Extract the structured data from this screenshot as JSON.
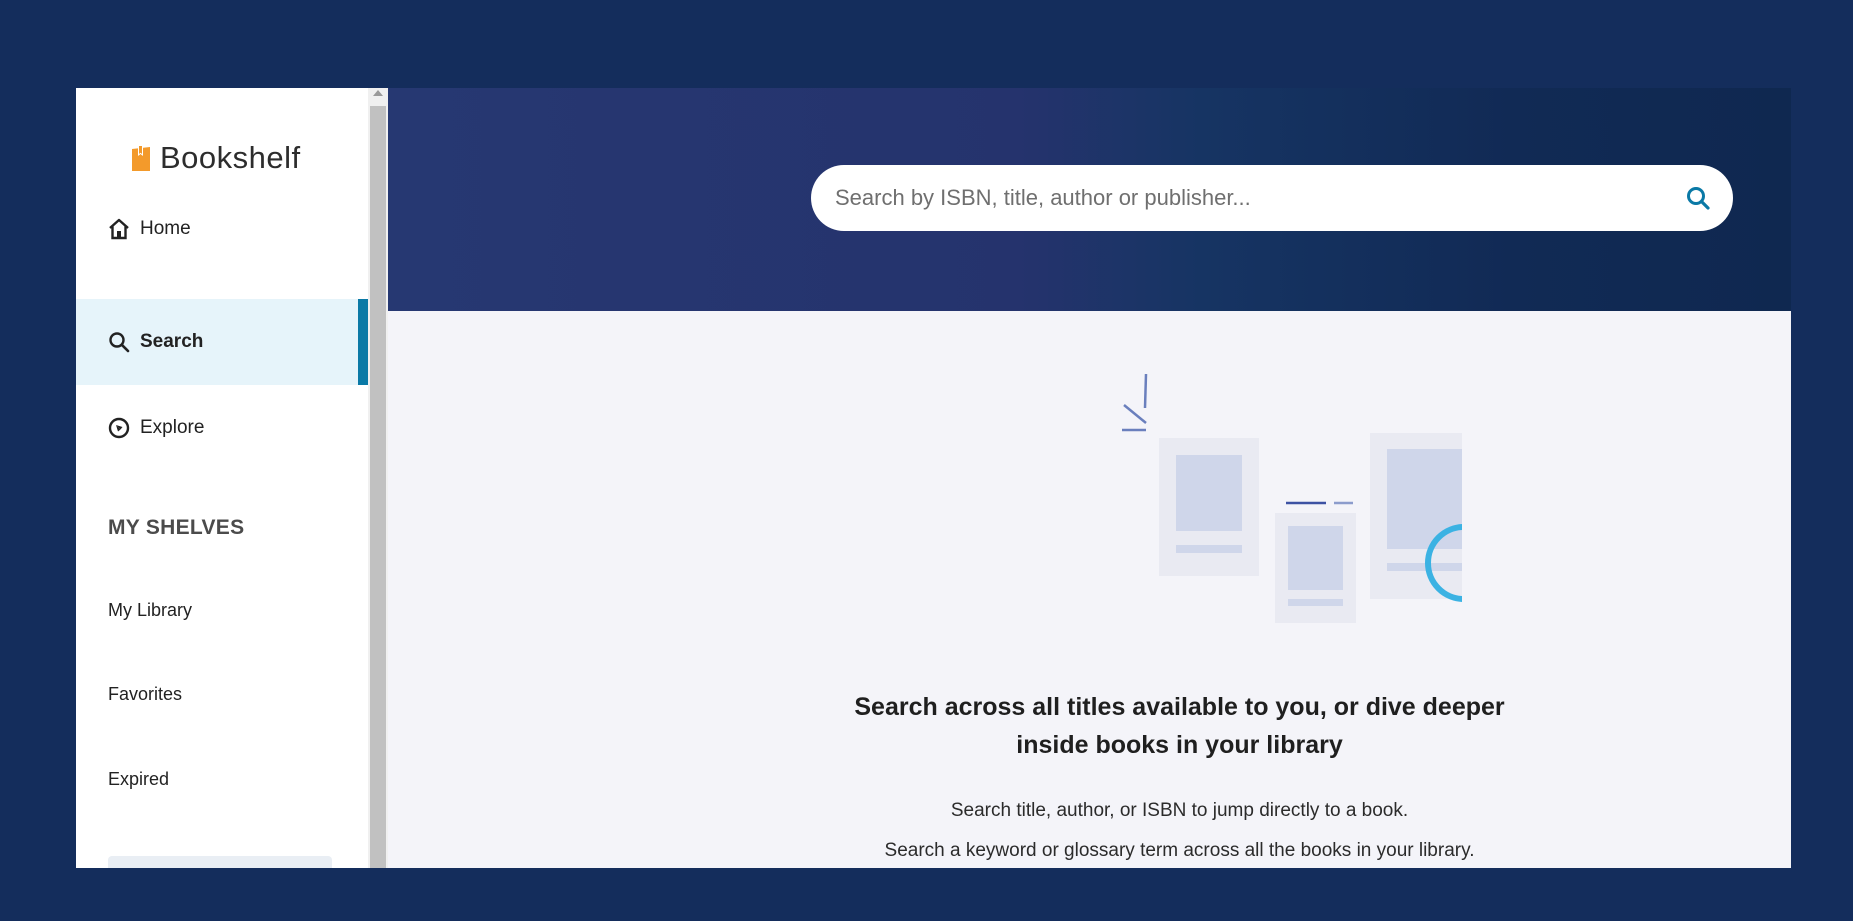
{
  "brand": {
    "name": "Bookshelf",
    "logo_color": "#f39a2b"
  },
  "sidebar": {
    "nav": [
      {
        "label": "Home",
        "icon": "home-icon"
      },
      {
        "label": "Search",
        "icon": "search-icon",
        "active": true
      },
      {
        "label": "Explore",
        "icon": "compass-icon"
      }
    ],
    "shelves_title": "MY SHELVES",
    "shelves": [
      "My Library",
      "Favorites",
      "Expired"
    ]
  },
  "header": {
    "search_placeholder": "Search by ISBN, title, author or publisher..."
  },
  "main": {
    "headline_line1": "Search across all titles available to you, or dive deeper",
    "headline_line2": "inside books in your library",
    "tip1": "Search title, author, or ISBN to jump directly to a book.",
    "tip2": "Search a keyword or glossary term across all the books in your library."
  },
  "colors": {
    "background": "#142d5c",
    "active_accent": "#0a79a6",
    "active_bg": "#e6f4fa",
    "magnifier": "#3bb2e3"
  }
}
